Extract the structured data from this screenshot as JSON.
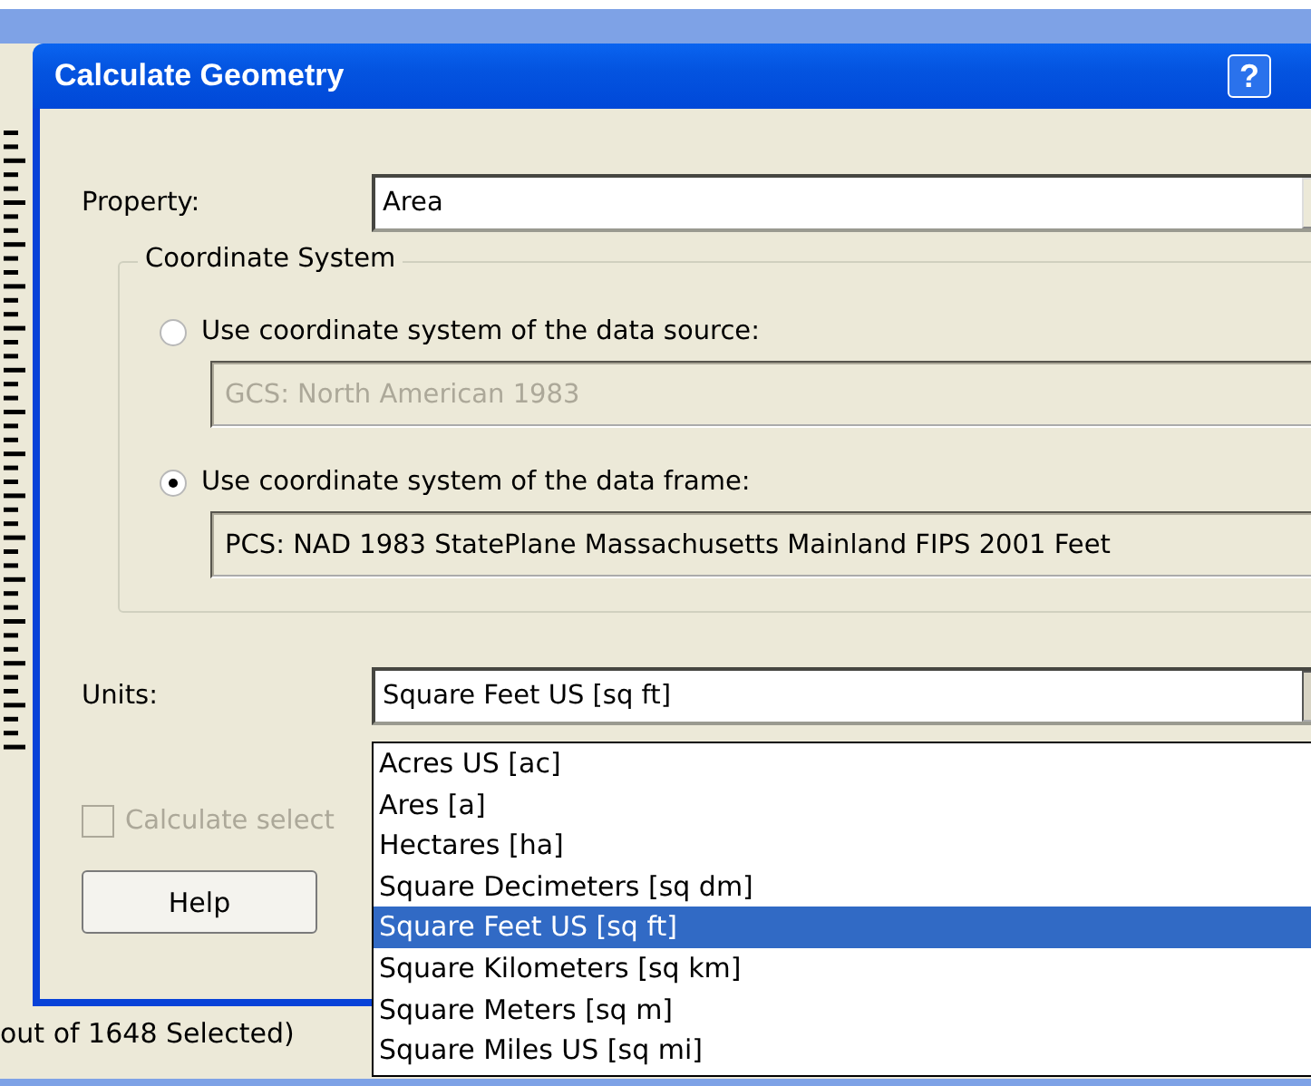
{
  "dialog": {
    "title": "Calculate Geometry",
    "help_button": "?",
    "property": {
      "label": "Property:",
      "value": "Area"
    },
    "coordinate_system": {
      "legend": "Coordinate System",
      "options": [
        {
          "label": "Use coordinate system of the data source:",
          "value": "GCS: North American 1983",
          "selected": false
        },
        {
          "label": "Use coordinate system of the data frame:",
          "value": "PCS: NAD 1983 StatePlane Massachusetts Mainland FIPS 2001 Feet",
          "selected": true
        }
      ]
    },
    "units": {
      "label": "Units:",
      "value": "Square Feet US [sq ft]",
      "expanded": true,
      "options": [
        {
          "label": "Acres US [ac]",
          "selected": false
        },
        {
          "label": "Ares [a]",
          "selected": false
        },
        {
          "label": "Hectares [ha]",
          "selected": false
        },
        {
          "label": "Square Decimeters [sq dm]",
          "selected": false
        },
        {
          "label": "Square Feet US [sq ft]",
          "selected": true
        },
        {
          "label": "Square Kilometers [sq km]",
          "selected": false
        },
        {
          "label": "Square Meters [sq m]",
          "selected": false
        },
        {
          "label": "Square Miles US [sq mi]",
          "selected": false
        }
      ]
    },
    "calculate_selected": {
      "label": "Calculate select",
      "checked": false,
      "disabled": true
    },
    "buttons": [
      "Help"
    ]
  },
  "background_window": {
    "status_text": "out of 1648 Selected)"
  }
}
